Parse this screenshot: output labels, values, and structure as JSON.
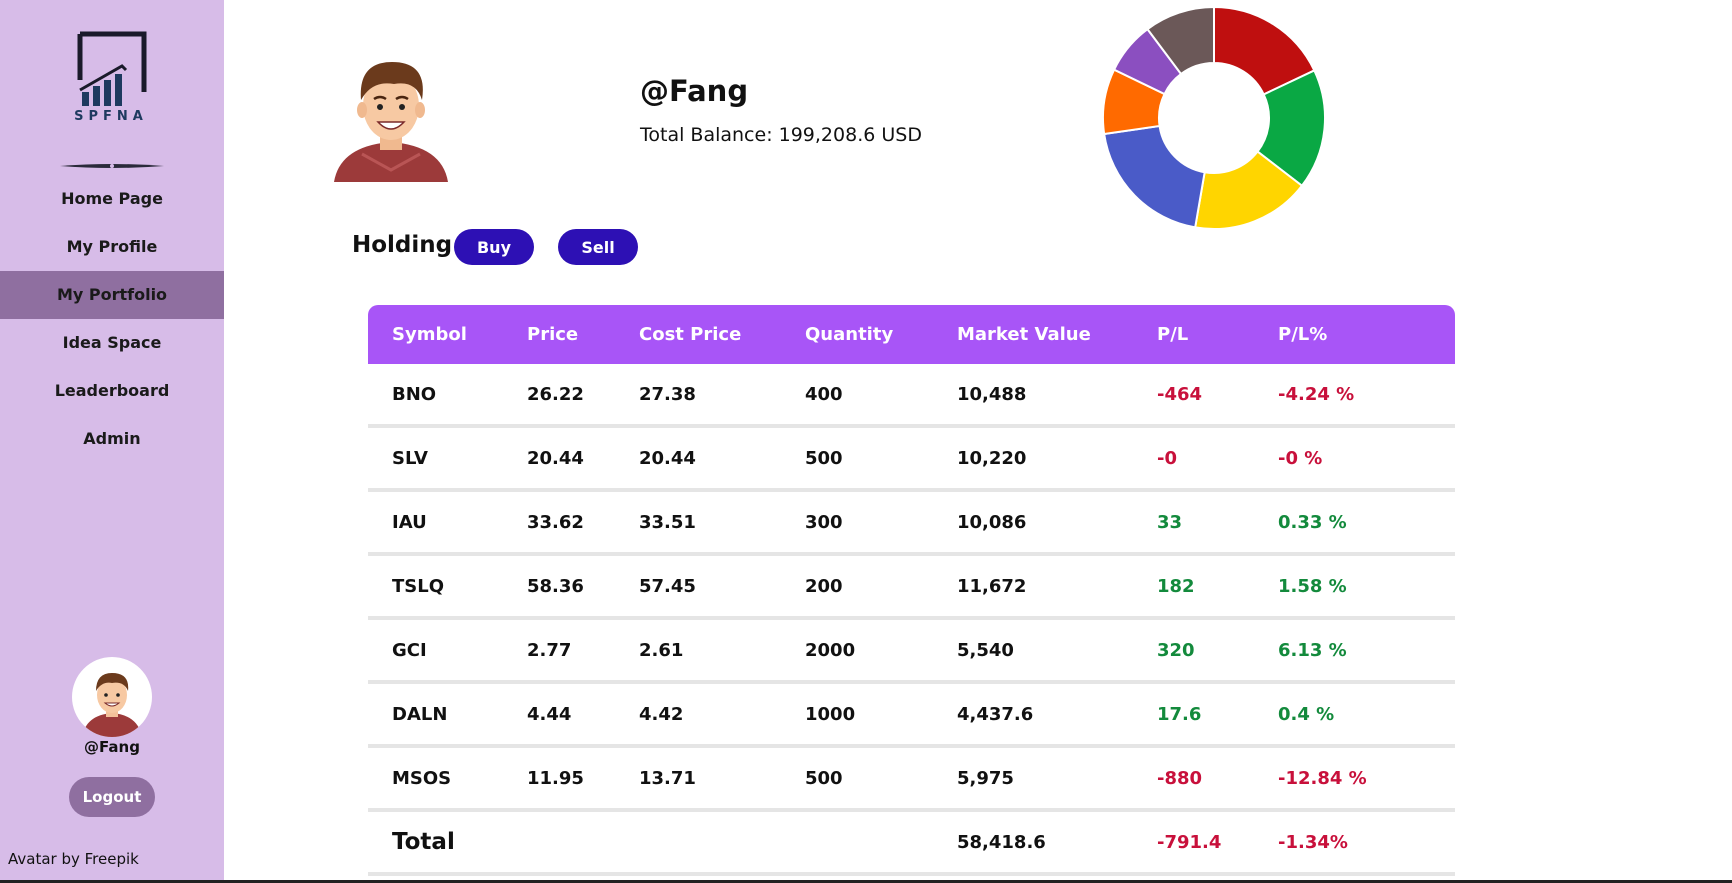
{
  "sidebar": {
    "logo_text": "SPFNA",
    "nav": [
      {
        "label": "Home Page",
        "active": false
      },
      {
        "label": "My Profile",
        "active": false
      },
      {
        "label": "My Portfolio",
        "active": true
      },
      {
        "label": "Idea Space",
        "active": false
      },
      {
        "label": "Leaderboard",
        "active": false
      },
      {
        "label": "Admin",
        "active": false
      }
    ],
    "username": "@Fang",
    "logout_label": "Logout",
    "credit": "Avatar by Freepik"
  },
  "profile": {
    "username": "@Fang",
    "balance": "Total Balance: 199,208.6 USD"
  },
  "holding": {
    "title": "Holding",
    "buy_label": "Buy",
    "sell_label": "Sell"
  },
  "table": {
    "headers": [
      "Symbol",
      "Price",
      "Cost Price",
      "Quantity",
      "Market Value",
      "P/L",
      "P/L%"
    ],
    "rows": [
      {
        "symbol": "BNO",
        "price": "26.22",
        "cost": "27.38",
        "qty": "400",
        "mv": "10,488",
        "pl": "-464",
        "plp": "-4.24 %",
        "sign": "neg"
      },
      {
        "symbol": "SLV",
        "price": "20.44",
        "cost": "20.44",
        "qty": "500",
        "mv": "10,220",
        "pl": "-0",
        "plp": "-0 %",
        "sign": "neg"
      },
      {
        "symbol": "IAU",
        "price": "33.62",
        "cost": "33.51",
        "qty": "300",
        "mv": "10,086",
        "pl": "33",
        "plp": "0.33 %",
        "sign": "pos"
      },
      {
        "symbol": "TSLQ",
        "price": "58.36",
        "cost": "57.45",
        "qty": "200",
        "mv": "11,672",
        "pl": "182",
        "plp": "1.58 %",
        "sign": "pos"
      },
      {
        "symbol": "GCI",
        "price": "2.77",
        "cost": "2.61",
        "qty": "2000",
        "mv": "5,540",
        "pl": "320",
        "plp": "6.13 %",
        "sign": "pos"
      },
      {
        "symbol": "DALN",
        "price": "4.44",
        "cost": "4.42",
        "qty": "1000",
        "mv": "4,437.6",
        "pl": "17.6",
        "plp": "0.4 %",
        "sign": "pos"
      },
      {
        "symbol": "MSOS",
        "price": "11.95",
        "cost": "13.71",
        "qty": "500",
        "mv": "5,975",
        "pl": "-880",
        "plp": "-12.84 %",
        "sign": "neg"
      }
    ],
    "total": {
      "label": "Total",
      "mv": "58,418.6",
      "pl": "-791.4",
      "plp": "-1.34%"
    }
  },
  "colors": {
    "sidebar_bg": "#d7bce8",
    "active_nav": "#8f6fa0",
    "header_bg": "#a855f7",
    "button": "#2d10b4",
    "negative": "#c8103b",
    "positive": "#138a3c"
  },
  "chart_data": {
    "type": "pie",
    "donut": true,
    "values": [
      10488,
      10220,
      10086,
      11672,
      5540,
      4437.6,
      5975
    ],
    "colors": [
      "#bf0f0f",
      "#0aa844",
      "#ffd500",
      "#4a5bc8",
      "#ff6a00",
      "#8b4fc0",
      "#6b5858"
    ]
  }
}
